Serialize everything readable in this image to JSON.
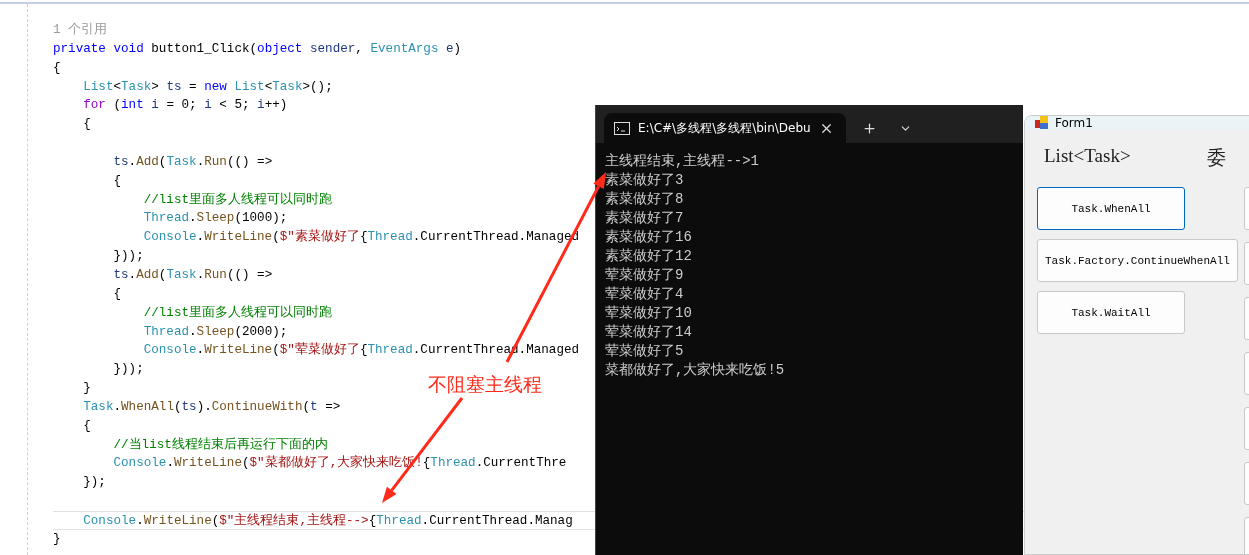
{
  "editor": {
    "lines": [
      {
        "kind": "code",
        "tokens": [
          {
            "kind": "ref",
            "t": "1 个引用"
          }
        ]
      },
      {
        "kind": "code",
        "tokens": [
          {
            "kind": "keyword",
            "t": "private void"
          },
          {
            "kind": "plain",
            "t": " button1_Click("
          },
          {
            "kind": "keyword",
            "t": "object"
          },
          {
            "kind": "ident",
            "t": " sender"
          },
          {
            "kind": "plain",
            "t": ","
          },
          {
            "kind": "type",
            "t": " EventArgs"
          },
          {
            "kind": "ident",
            "t": " e"
          },
          {
            "kind": "plain",
            "t": ")"
          }
        ]
      },
      {
        "kind": "code",
        "tokens": [
          {
            "kind": "plain",
            "t": "{"
          }
        ]
      },
      {
        "kind": "code",
        "tokens": [
          {
            "kind": "type",
            "t": "    List"
          },
          {
            "kind": "plain",
            "t": "<"
          },
          {
            "kind": "type",
            "t": "Task"
          },
          {
            "kind": "plain",
            "t": ">"
          },
          {
            "kind": "ident",
            "t": " ts"
          },
          {
            "kind": "plain",
            "t": " ="
          },
          {
            "kind": "keyword",
            "t": " new"
          },
          {
            "kind": "type",
            "t": " List"
          },
          {
            "kind": "plain",
            "t": "<"
          },
          {
            "kind": "type",
            "t": "Task"
          },
          {
            "kind": "plain",
            "t": ">();"
          }
        ]
      },
      {
        "kind": "code",
        "tokens": [
          {
            "kind": "control",
            "t": "    for"
          },
          {
            "kind": "plain",
            "t": " ("
          },
          {
            "kind": "keyword",
            "t": "int"
          },
          {
            "kind": "ident",
            "t": " i"
          },
          {
            "kind": "plain",
            "t": " = 0;"
          },
          {
            "kind": "ident",
            "t": " i"
          },
          {
            "kind": "plain",
            "t": " < 5;"
          },
          {
            "kind": "ident",
            "t": " i"
          },
          {
            "kind": "plain",
            "t": "++)"
          }
        ]
      },
      {
        "kind": "code",
        "tokens": [
          {
            "kind": "plain",
            "t": "    {"
          }
        ]
      },
      {
        "kind": "blank"
      },
      {
        "kind": "code",
        "tokens": [
          {
            "kind": "ident",
            "t": "        ts"
          },
          {
            "kind": "plain",
            "t": "."
          },
          {
            "kind": "method",
            "t": "Add"
          },
          {
            "kind": "plain",
            "t": "("
          },
          {
            "kind": "type",
            "t": "Task"
          },
          {
            "kind": "plain",
            "t": "."
          },
          {
            "kind": "method",
            "t": "Run"
          },
          {
            "kind": "plain",
            "t": "(() =>"
          }
        ]
      },
      {
        "kind": "code",
        "tokens": [
          {
            "kind": "plain",
            "t": "        {"
          }
        ]
      },
      {
        "kind": "code",
        "tokens": [
          {
            "kind": "comment",
            "t": "            //list里面多人线程可以同时跑"
          }
        ]
      },
      {
        "kind": "code",
        "tokens": [
          {
            "kind": "type",
            "t": "            Thread"
          },
          {
            "kind": "plain",
            "t": "."
          },
          {
            "kind": "method",
            "t": "Sleep"
          },
          {
            "kind": "plain",
            "t": "(1000);"
          }
        ]
      },
      {
        "kind": "code",
        "tokens": [
          {
            "kind": "type",
            "t": "            Console"
          },
          {
            "kind": "plain",
            "t": "."
          },
          {
            "kind": "method",
            "t": "WriteLine"
          },
          {
            "kind": "plain",
            "t": "("
          },
          {
            "kind": "string",
            "t": "$\"素菜做好了"
          },
          {
            "kind": "plain",
            "t": "{"
          },
          {
            "kind": "type",
            "t": "Thread"
          },
          {
            "kind": "plain",
            "t": ".CurrentThread.Managed"
          }
        ]
      },
      {
        "kind": "code",
        "tokens": [
          {
            "kind": "plain",
            "t": "        }));"
          }
        ]
      },
      {
        "kind": "code",
        "tokens": [
          {
            "kind": "ident",
            "t": "        ts"
          },
          {
            "kind": "plain",
            "t": "."
          },
          {
            "kind": "method",
            "t": "Add"
          },
          {
            "kind": "plain",
            "t": "("
          },
          {
            "kind": "type",
            "t": "Task"
          },
          {
            "kind": "plain",
            "t": "."
          },
          {
            "kind": "method",
            "t": "Run"
          },
          {
            "kind": "plain",
            "t": "(() =>"
          }
        ]
      },
      {
        "kind": "code",
        "tokens": [
          {
            "kind": "plain",
            "t": "        {"
          }
        ]
      },
      {
        "kind": "code",
        "tokens": [
          {
            "kind": "comment",
            "t": "            //list里面多人线程可以同时跑"
          }
        ]
      },
      {
        "kind": "code",
        "tokens": [
          {
            "kind": "type",
            "t": "            Thread"
          },
          {
            "kind": "plain",
            "t": "."
          },
          {
            "kind": "method",
            "t": "Sleep"
          },
          {
            "kind": "plain",
            "t": "(2000);"
          }
        ]
      },
      {
        "kind": "code",
        "tokens": [
          {
            "kind": "type",
            "t": "            Console"
          },
          {
            "kind": "plain",
            "t": "."
          },
          {
            "kind": "method",
            "t": "WriteLine"
          },
          {
            "kind": "plain",
            "t": "("
          },
          {
            "kind": "string",
            "t": "$\"荤菜做好了"
          },
          {
            "kind": "plain",
            "t": "{"
          },
          {
            "kind": "type",
            "t": "Thread"
          },
          {
            "kind": "plain",
            "t": ".CurrentThread.Managed"
          }
        ]
      },
      {
        "kind": "code",
        "tokens": [
          {
            "kind": "plain",
            "t": "        }));"
          }
        ]
      },
      {
        "kind": "code",
        "tokens": [
          {
            "kind": "plain",
            "t": "    }"
          }
        ]
      },
      {
        "kind": "code",
        "tokens": [
          {
            "kind": "type",
            "t": "    Task"
          },
          {
            "kind": "plain",
            "t": "."
          },
          {
            "kind": "method",
            "t": "WhenAll"
          },
          {
            "kind": "plain",
            "t": "("
          },
          {
            "kind": "ident",
            "t": "ts"
          },
          {
            "kind": "plain",
            "t": ")."
          },
          {
            "kind": "method",
            "t": "ContinueWith"
          },
          {
            "kind": "plain",
            "t": "("
          },
          {
            "kind": "ident",
            "t": "t"
          },
          {
            "kind": "plain",
            "t": " =>"
          }
        ]
      },
      {
        "kind": "code",
        "tokens": [
          {
            "kind": "plain",
            "t": "    {"
          }
        ]
      },
      {
        "kind": "code",
        "tokens": [
          {
            "kind": "comment",
            "t": "        //当list线程结束后再运行下面的内"
          }
        ]
      },
      {
        "kind": "code",
        "tokens": [
          {
            "kind": "type",
            "t": "        Console"
          },
          {
            "kind": "plain",
            "t": "."
          },
          {
            "kind": "method",
            "t": "WriteLine"
          },
          {
            "kind": "plain",
            "t": "("
          },
          {
            "kind": "string",
            "t": "$\"菜都做好了,大家快来吃饭!"
          },
          {
            "kind": "plain",
            "t": "{"
          },
          {
            "kind": "type",
            "t": "Thread"
          },
          {
            "kind": "plain",
            "t": ".CurrentThre"
          }
        ]
      },
      {
        "kind": "code",
        "tokens": [
          {
            "kind": "plain",
            "t": "    });"
          }
        ]
      },
      {
        "kind": "blank"
      },
      {
        "kind": "current",
        "tokens": [
          {
            "kind": "type",
            "t": "    Console"
          },
          {
            "kind": "plain",
            "t": "."
          },
          {
            "kind": "method",
            "t": "WriteLine"
          },
          {
            "kind": "plain",
            "t": "("
          },
          {
            "kind": "string",
            "t": "$\"主线程结束,主线程-->"
          },
          {
            "kind": "plain",
            "t": "{"
          },
          {
            "kind": "type",
            "t": "Thread"
          },
          {
            "kind": "plain",
            "t": ".CurrentThread.Manag"
          }
        ]
      },
      {
        "kind": "code",
        "tokens": [
          {
            "kind": "plain",
            "t": "}"
          }
        ]
      }
    ]
  },
  "annotation": {
    "text": "不阻塞主线程"
  },
  "console": {
    "tab_title": "E:\\C#\\多线程\\多线程\\bin\\Debu",
    "lines": [
      "主线程结束,主线程-->1",
      "素菜做好了3",
      "素菜做好了8",
      "素菜做好了7",
      "素菜做好了16",
      "素菜做好了12",
      "荤菜做好了9",
      "荤菜做好了4",
      "荤菜做好了10",
      "荤菜做好了14",
      "荤菜做好了5",
      "菜都做好了,大家快来吃饭!5"
    ]
  },
  "form": {
    "title": "Form1",
    "headings": [
      "List<Task>",
      "委"
    ],
    "buttons": [
      {
        "label": "Task.WhenAll",
        "focused": true
      },
      {
        "label": "Task.Factory.ContinueWhenAll",
        "focused": false
      },
      {
        "label": "Task.WaitAll",
        "focused": false
      }
    ],
    "clipped_buttons": [
      {
        "kind": "button"
      },
      {
        "kind": "button"
      },
      {
        "kind": "button"
      },
      {
        "kind": "button"
      },
      {
        "kind": "button"
      },
      {
        "kind": "button"
      },
      {
        "kind": "button"
      }
    ]
  }
}
